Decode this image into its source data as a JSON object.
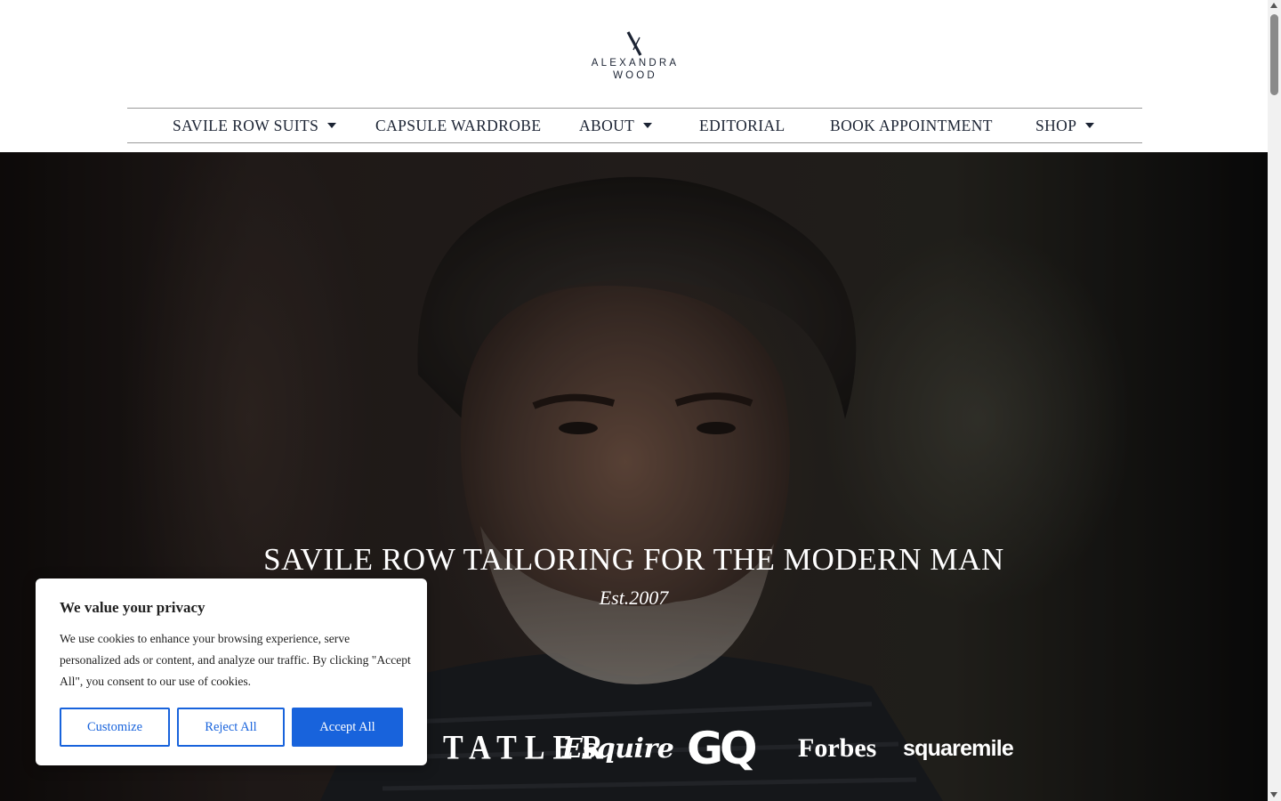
{
  "brand": {
    "line1": "ALEXANDRA",
    "line2": "WOOD"
  },
  "nav": {
    "items": [
      {
        "label": "SAVILE ROW SUITS",
        "has_dropdown": true
      },
      {
        "label": "CAPSULE WARDROBE",
        "has_dropdown": false
      },
      {
        "label": "ABOUT",
        "has_dropdown": true
      },
      {
        "label": "EDITORIAL",
        "has_dropdown": false
      },
      {
        "label": "BOOK APPOINTMENT",
        "has_dropdown": false
      },
      {
        "label": "SHOP",
        "has_dropdown": true
      }
    ]
  },
  "hero": {
    "title": "SAVILE ROW TAILORING FOR THE MODERN MAN",
    "subtitle": "Est.2007",
    "press": [
      "TATLER",
      "Esquire",
      "GQ",
      "Forbes",
      "squaremile"
    ]
  },
  "cookie": {
    "title": "We value your privacy",
    "text": "We use cookies to enhance your browsing experience, serve personalized ads or content, and analyze our traffic. By clicking \"Accept All\", you consent to our use of cookies.",
    "customize_label": "Customize",
    "reject_label": "Reject All",
    "accept_label": "Accept All",
    "accent_color": "#1863dc"
  },
  "colors": {
    "nav_text": "#1b2333",
    "hero_text": "#ffffff"
  }
}
